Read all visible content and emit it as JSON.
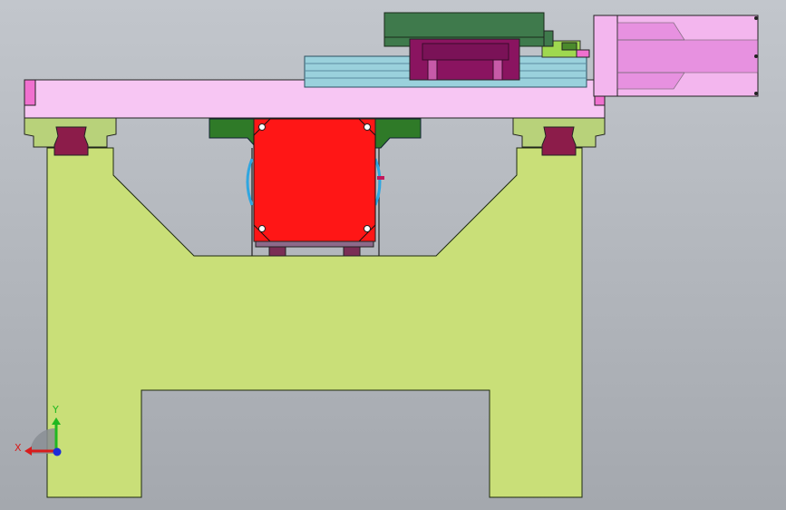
{
  "viewport": {
    "background_top": "#c2c6cc",
    "background_bottom": "#a4a8ae"
  },
  "colors": {
    "frame": "#c9df78",
    "frame_stroke": "#1e2a10",
    "beam": "#f7c6f3",
    "beam_end": "#f070cf",
    "rail_block": "#b8d27a",
    "rail_profile": "#8c1c4a",
    "motor_mount_green": "#2f7a28",
    "red_component": "#ff1616",
    "slide_rail": "#9ad1dc",
    "slide_carriage": "#8a1460",
    "top_plate": "#3f7a4c",
    "motor_body": "#f3b6ee",
    "motor_shade": "#e07ad8",
    "coupling": "#9fd84f",
    "foot_pad": "#7a2e55"
  },
  "triad": {
    "icon": "coordinate-triad-icon",
    "x_label": "X",
    "y_label": "Y",
    "x_color": "#d81c1c",
    "y_color": "#20b820",
    "z_color": "#1c2cd8"
  }
}
